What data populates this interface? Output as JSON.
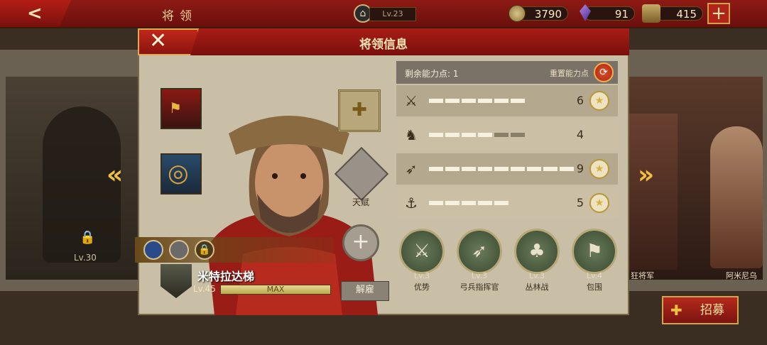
{
  "topbar": {
    "title": "将领",
    "level": "Lv.23",
    "coins": "3790",
    "gems": "91",
    "chest": "415",
    "add_label": "+"
  },
  "background": {
    "locked_level": "Lv.30",
    "right_name_1": "狂将军",
    "right_name_2": "阿米尼乌"
  },
  "dialog": {
    "title": "将领信息",
    "talent_label": "天赋",
    "hero_name": "米特拉达梯",
    "hero_level": "Lv.45",
    "xp_label": "MAX",
    "dismiss_label": "解雇",
    "recruit_label": "招募"
  },
  "stats": {
    "remaining_points_label": "剩余能力点: 1",
    "reset_label": "重置能力点",
    "rows": [
      {
        "icon": "sword-icon",
        "value": "6",
        "max_segments": 6,
        "filled": 6,
        "medal": true
      },
      {
        "icon": "horse-icon",
        "value": "4",
        "max_segments": 6,
        "filled": 4,
        "medal": false
      },
      {
        "icon": "bow-icon",
        "value": "9",
        "max_segments": 9,
        "filled": 9,
        "medal": true
      },
      {
        "icon": "anchor-icon",
        "value": "5",
        "max_segments": 5,
        "filled": 5,
        "medal": true
      }
    ]
  },
  "skills": [
    {
      "level": "Lv.3",
      "name": "优势"
    },
    {
      "level": "Lv.3",
      "name": "弓兵指挥官"
    },
    {
      "level": "Lv.3",
      "name": "丛林战"
    },
    {
      "level": "Lv.4",
      "name": "包围"
    }
  ],
  "colors": {
    "header_red": "#8e1a14",
    "gold": "#d4a44a",
    "panel": "#c9bfa6"
  }
}
